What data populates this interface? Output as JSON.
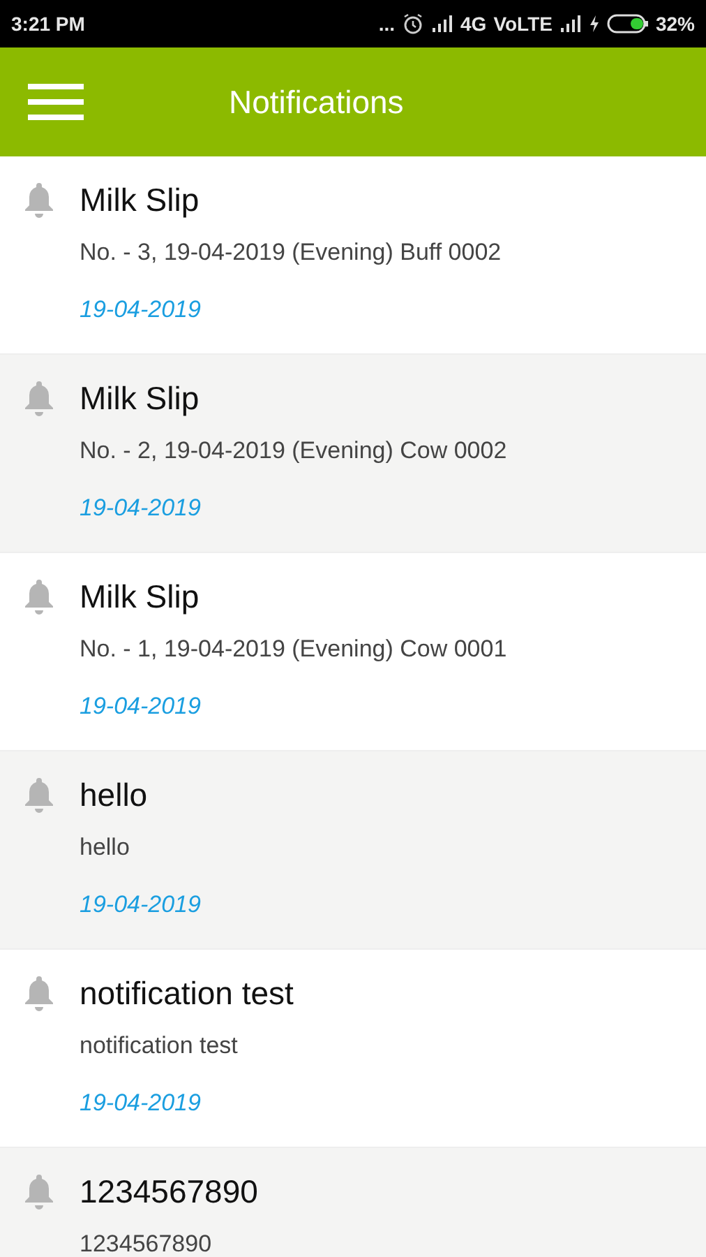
{
  "status_bar": {
    "time": "3:21 PM",
    "more": "...",
    "network": "4G",
    "volte": "VoLTE",
    "battery": "32%"
  },
  "app_bar": {
    "title": "Notifications"
  },
  "notifications": [
    {
      "title": "Milk Slip",
      "body": "No. - 3, 19-04-2019 (Evening) Buff 0002",
      "date": "19-04-2019"
    },
    {
      "title": "Milk Slip",
      "body": "No. - 2, 19-04-2019 (Evening) Cow 0002",
      "date": "19-04-2019"
    },
    {
      "title": "Milk Slip",
      "body": "No. - 1, 19-04-2019 (Evening) Cow 0001",
      "date": "19-04-2019"
    },
    {
      "title": "hello",
      "body": "hello",
      "date": "19-04-2019"
    },
    {
      "title": "notification test",
      "body": "notification test",
      "date": "19-04-2019"
    },
    {
      "title": "1234567890",
      "body": "1234567890"
    }
  ]
}
